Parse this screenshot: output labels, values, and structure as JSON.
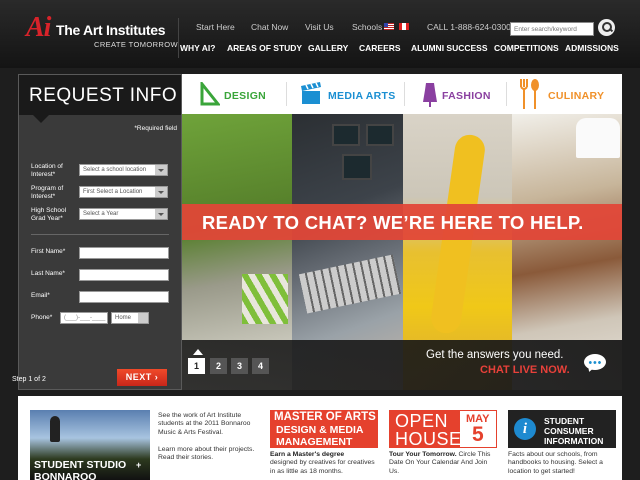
{
  "header": {
    "logo_mark": "Ai",
    "logo_name": "The Art Institutes",
    "logo_tagline": "CREATE TOMORROW",
    "utility_links": [
      "Start Here",
      "Chat Now",
      "Visit Us",
      "Schools"
    ],
    "phone": "CALL 1-888-624-0300",
    "search_placeholder": "Enter search/keyword",
    "nav": [
      "WHY AI?",
      "AREAS OF STUDY",
      "GALLERY",
      "CAREERS",
      "ALUMNI SUCCESS",
      "COMPETITIONS",
      "ADMISSIONS"
    ]
  },
  "request": {
    "title": "REQUEST INFO",
    "required_note": "*Required field",
    "location_label_1": "Location of",
    "location_label_2": "Interest*",
    "location_value": "Select a school location",
    "program_label_1": "Program of",
    "program_label_2": "Interest*",
    "program_value": "First Select a Location",
    "grad_label_1": "High School",
    "grad_label_2": "Grad Year*",
    "grad_value": "Select a Year",
    "first_name_label": "First Name*",
    "last_name_label": "Last Name*",
    "email_label": "Email*",
    "phone_label": "Phone*",
    "phone_format": "(___)-___-____",
    "phone_type": "Home",
    "step": "Step 1 of 2",
    "next": "NEXT ›"
  },
  "categories": [
    {
      "label": "DESIGN",
      "color": "#3aa53a"
    },
    {
      "label": "MEDIA ARTS",
      "color": "#1b8fd2"
    },
    {
      "label": "FASHION",
      "color": "#8a3fa0"
    },
    {
      "label": "CULINARY",
      "color": "#f0912a"
    }
  ],
  "hero": {
    "banner": "READY TO CHAT? WE’RE HERE TO HELP.",
    "cta_line1": "Get the answers you need.",
    "cta_line2": "CHAT LIVE NOW.",
    "pages": [
      "1",
      "2",
      "3",
      "4"
    ],
    "active_page": 1
  },
  "promos": {
    "studio_label1": "STUDENT STUDIO",
    "studio_plus": "+",
    "studio_label2": "BONNAROO",
    "studio_text1": "See the work of Art Institute students at the 2011 Bonnaroo Music & Arts Festival.",
    "studio_text2": "Learn more about their projects. Read their stories.",
    "master_l1": "MASTER OF ARTS",
    "master_l2": "DESIGN & MEDIA",
    "master_l3": "MANAGEMENT",
    "master_title": "Earn a Master's degree",
    "master_text": "designed by creatives for creatives in as little as 18 months.",
    "open_l1": "OPEN",
    "open_l2": "HOUSE",
    "open_month": "MAY",
    "open_day": "5",
    "open_title": "Tour Your Tomorrow.",
    "open_text": "Circle This Date On Your Calendar And Join Us.",
    "info_l1": "STUDENT",
    "info_l2": "CONSUMER",
    "info_l3": "INFORMATION",
    "info_text": "Facts about our schools, from handbooks to housing. Select a location to get started!"
  }
}
